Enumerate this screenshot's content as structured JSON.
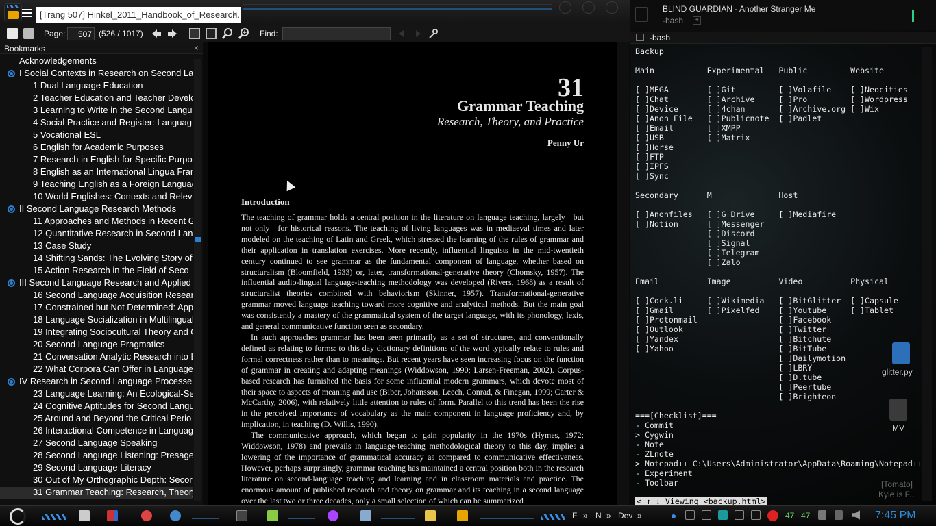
{
  "pdf_viewer": {
    "tab_title": "[Trang 507] Hinkel_2011_Handbook_of_Research...",
    "tab_close": "×",
    "toolbar": {
      "page_label": "Page:",
      "page_value": "507",
      "page_count": "(526 / 1017)",
      "find_label": "Find:",
      "find_value": ""
    },
    "sidebar": {
      "title": "Bookmarks",
      "close": "×",
      "items": [
        {
          "label": "Acknowledgements",
          "level": 0,
          "node": false
        },
        {
          "label": "I Social Contexts in Research on Second La",
          "level": 0,
          "node": true
        },
        {
          "label": "1 Dual Language Education",
          "level": 1
        },
        {
          "label": "2 Teacher Education and Teacher Develo",
          "level": 1
        },
        {
          "label": "3 Learning to Write in the Second Langu",
          "level": 1
        },
        {
          "label": "4 Social Practice and Register: Languag",
          "level": 1
        },
        {
          "label": "5 Vocational ESL",
          "level": 1
        },
        {
          "label": "6 English for Academic Purposes",
          "level": 1
        },
        {
          "label": "7 Research in English for Specific Purpo",
          "level": 1
        },
        {
          "label": "8 English as an International Lingua Fran",
          "level": 1
        },
        {
          "label": "9 Teaching English as a Foreign Languag",
          "level": 1
        },
        {
          "label": "10 World Englishes: Contexts and Relev",
          "level": 1
        },
        {
          "label": "II Second Language Research Methods",
          "level": 0,
          "node": true
        },
        {
          "label": "11 Approaches and Methods in Recent G",
          "level": 1
        },
        {
          "label": "12 Quantitative Research in Second Lan",
          "level": 1
        },
        {
          "label": "13 Case Study",
          "level": 1
        },
        {
          "label": "14 Shifting Sands: The Evolving Story of",
          "level": 1
        },
        {
          "label": "15 Action Research in the Field of Seco",
          "level": 1
        },
        {
          "label": "III Second Language Research and Applied L",
          "level": 0,
          "node": true
        },
        {
          "label": "16 Second Language Acquisition Resear",
          "level": 1
        },
        {
          "label": "17 Constrained but Not Determined: App",
          "level": 1
        },
        {
          "label": "18 Language Socialization in Multilingual",
          "level": 1
        },
        {
          "label": "19 Integrating Sociocultural Theory and C",
          "level": 1
        },
        {
          "label": "20 Second Language Pragmatics",
          "level": 1
        },
        {
          "label": "21 Conversation Analytic Research into L",
          "level": 1
        },
        {
          "label": "22 What Corpora Can Offer in Language",
          "level": 1
        },
        {
          "label": "IV Research in Second Language Processe",
          "level": 0,
          "node": true
        },
        {
          "label": "23 Language Learning: An Ecological-Se",
          "level": 1
        },
        {
          "label": "24 Cognitive Aptitudes for Second Langu",
          "level": 1
        },
        {
          "label": "25 Around and Beyond the Critical Perio",
          "level": 1
        },
        {
          "label": "26 Interactional Competence in Languag",
          "level": 1
        },
        {
          "label": "27 Second Language Speaking",
          "level": 1
        },
        {
          "label": "28 Second Language Listening: Presage",
          "level": 1
        },
        {
          "label": "29 Second Language Literacy",
          "level": 1
        },
        {
          "label": "30 Out of My Orthographic Depth: Secor",
          "level": 1
        },
        {
          "label": "31 Grammar Teaching: Research, Theory",
          "level": 1,
          "selected": true
        }
      ]
    },
    "page": {
      "chapter_number": "31",
      "chapter_title": "Grammar Teaching",
      "chapter_subtitle": "Research, Theory, and Practice",
      "author": "Penny Ur",
      "section_heading": "Introduction",
      "paragraphs": [
        "The teaching of grammar holds a central position in the literature on language teaching, largely—but not only—for historical reasons. The teaching of living languages was in mediaeval times and later modeled on the teaching of Latin and Greek, which stressed the learning of the rules of grammar and their application in translation exercises. More recently, influential linguists in the mid-twentieth century continued to see grammar as the fundamental component of language, whether based on structuralism (Bloomfield, 1933) or, later, transformational-generative theory (Chomsky, 1957). The influential audio-lingual language-teaching methodology was developed (Rivers, 1968) as a result of structuralist theories combined with behaviorism (Skinner, 1957). Transformational-generative grammar moved language teaching toward more cognitive and analytical methods. But the main goal was consistently a mastery of the grammatical system of the target language, with its phonology, lexis, and general communicative function seen as secondary.",
        "In such approaches grammar has been seen primarily as a set of structures, and conventionally defined as relating to forms: to this day dictionary definitions of the word typically relate to rules and formal correctness rather than to meanings. But recent years have seen increasing focus on the function of grammar in creating and adapting meanings (Widdowson, 1990; Larsen-Freeman, 2002). Corpus-based research has furnished the basis for some influential modern grammars, which devote most of their space to aspects of meaning and use (Biber, Johansson, Leech, Conrad, & Finegan, 1999; Carter & McCarthy, 2006), with relatively little attention to rules of form. Parallel to this trend has been the rise in the perceived importance of vocabulary as the main component in language proficiency and, by implication, in teaching (D. Willis, 1990).",
        "The communicative approach, which began to gain popularity in the 1970s (Hymes, 1972; Widdowson, 1978) and prevails in language-teaching methodological theory to this day, implies a lowering of the importance of grammatical accuracy as compared to communicative effectiveness. However, perhaps surprisingly, grammar teaching has maintained a central position both in the research literature on second-language teaching and learning and in classroom materials and practice. The enormous amount of published research and theory on grammar and its teaching in a second language over the last two or three decades, only a small selection of which can be summarized"
      ]
    }
  },
  "terminal": {
    "window_title": "BLIND GUARDIAN - Another Stranger Me",
    "tab_label": "-bash",
    "new_tab": "+",
    "pane_title": "-bash",
    "content": "Backup\n\nMain           Experimental   Public         Website\n\n[ ]MEGA        [ ]Git         [ ]Volafile    [ ]Neocities\n[ ]Chat        [ ]Archive     [ ]Pro         [ ]Wordpress\n[ ]Device      [ ]4chan       [ ]Archive.org [ ]Wix\n[ ]Anon File   [ ]Publicnote  [ ]Padlet\n[ ]Email       [ ]XMPP\n[ ]USB         [ ]Matrix\n[ ]Horse\n[ ]FTP\n[ ]IPFS\n[ ]Sync\n\nSecondary      M              Host\n\n[ ]Anonfiles   [ ]G Drive     [ ]Mediafire\n[ ]Notion      [ ]Messenger\n               [ ]Discord\n               [ ]Signal\n               [ ]Telegram\n               [ ]Zalo\n\nEmail          Image          Video          Physical\n\n[ ]Cock.li     [ ]Wikimedia   [ ]BitGlitter  [ ]Capsule\n[ ]Gmail       [ ]Pixelfed    [ ]Youtube     [ ]Tablet\n[ ]Protonmail                 [ ]Facebook\n[ ]Outlook                    [ ]Twitter\n[ ]Yandex                     [ ]Bitchute\n[ ]Yahoo                      [ ]BitTube\n                              [ ]Dailymotion\n                              [ ]LBRY\n                              [ ]D.tube\n                              [ ]Peertube\n                              [ ]Brighteon\n\n===[Checklist]===\n- Commit\n> Cygwin\n- Note\n- ZLnote\n> Notepad++ C:\\Users\\Administrator\\AppData\\Roaming\\Notepad++\n- Experiment\n- Toolbar",
    "status_line": "< ↑ ↓ Viewing <backup.html>"
  },
  "desktop": {
    "icons": [
      {
        "label": "glitter.py"
      },
      {
        "label": "MV"
      },
      {
        "label": "[Tomato]"
      },
      {
        "label": "Kyle is F..."
      }
    ]
  },
  "taskbar": {
    "quick_labels": [
      "F",
      "»",
      "N",
      "»",
      "Dev",
      "»"
    ],
    "tray_numbers": [
      "47",
      "47"
    ],
    "clock": "7:45 PM"
  },
  "colors": {
    "accent": "#2e8cd8",
    "sidebar_node": "#2a7fd0",
    "terminal_indicator": "#2ed08a"
  }
}
